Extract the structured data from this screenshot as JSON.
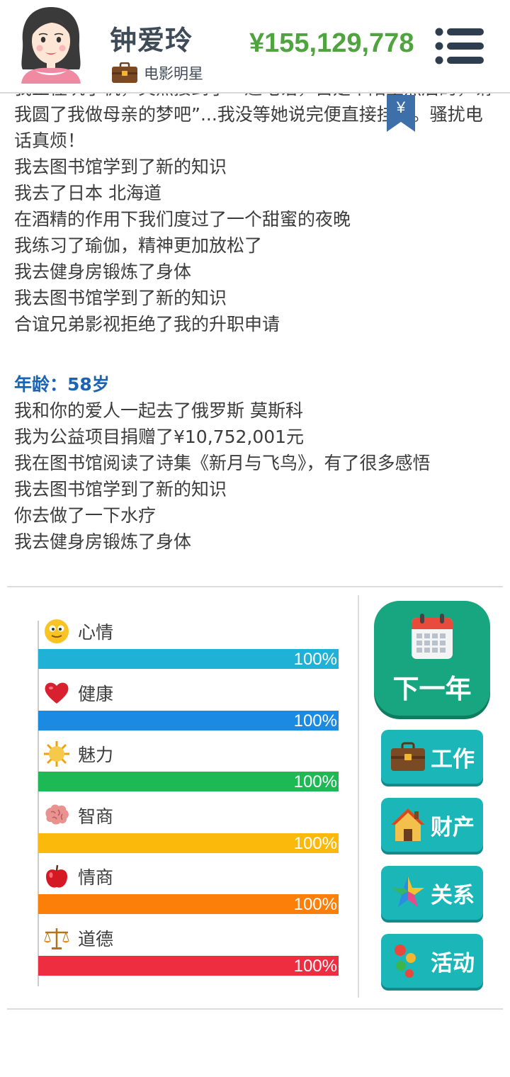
{
  "header": {
    "name": "钟爱玲",
    "job": "电影明星",
    "money": "¥155,129,778"
  },
  "log": {
    "wrapped_top": "我正往筑了机，突然接到了一通电话，自是个陌生然后的，请我圆了我做母亲的梦吧”...我没等她说完便直接挂断。骚扰电话真烦！",
    "lines_before": [
      "我去图书馆学到了新的知识",
      "我去了日本 北海道",
      "在酒精的作用下我们度过了一个甜蜜的夜晚",
      "我练习了瑜伽，精神更加放松了",
      "我去健身房锻炼了身体",
      "我去图书馆学到了新的知识",
      "合谊兄弟影视拒绝了我的升职申请"
    ],
    "age_heading": "年龄：58岁",
    "lines_after": [
      "我和你的爱人一起去了俄罗斯 莫斯科",
      "我为公益项目捐赠了¥10,752,001元",
      "我在图书馆阅读了诗集《新月与飞鸟》，有了很多感悟",
      "我去图书馆学到了新的知识",
      "你去做了一下水疗",
      "我去健身房锻炼了身体"
    ],
    "ribbon_symbol": "¥"
  },
  "stats": [
    {
      "name": "心情",
      "value": "100%",
      "level": 1.0,
      "color": "#1fb1d6",
      "icon": "smiley-icon"
    },
    {
      "name": "健康",
      "value": "100%",
      "level": 1.0,
      "color": "#1b8ae3",
      "icon": "heart-icon"
    },
    {
      "name": "魅力",
      "value": "100%",
      "level": 1.0,
      "color": "#1db954",
      "icon": "sun-icon"
    },
    {
      "name": "智商",
      "value": "100%",
      "level": 1.0,
      "color": "#fbb90b",
      "icon": "brain-icon"
    },
    {
      "name": "情商",
      "value": "100%",
      "level": 1.0,
      "color": "#fb7f08",
      "icon": "apple-icon"
    },
    {
      "name": "道德",
      "value": "100%",
      "level": 1.0,
      "color": "#ee2e40",
      "icon": "scales-icon"
    }
  ],
  "actions": {
    "next_year": "下一年",
    "work": "工作",
    "property": "财产",
    "relations": "关系",
    "activities": "活动"
  },
  "colors": {
    "money": "#4fa43f",
    "age_heading": "#1b63b5",
    "next_button": "#17a67f",
    "action_button": "#1ab6b8"
  }
}
